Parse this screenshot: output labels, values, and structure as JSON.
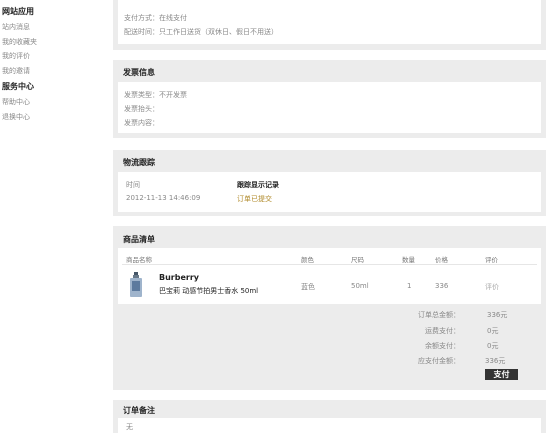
{
  "sidebar": {
    "sections": [
      {
        "title": "网站应用",
        "items": [
          "站内消息",
          "我的收藏夹",
          "我的评价",
          "我的邀请"
        ]
      },
      {
        "title": "服务中心",
        "items": [
          "帮助中心",
          "退换中心"
        ]
      }
    ]
  },
  "payment": {
    "method_line": "支付方式：在线支付",
    "time_line": "配送时间：只工作日送货（双休日、假日不用送）"
  },
  "invoice": {
    "title": "发票信息",
    "type_line": "发票类型：不开发票",
    "header_line": "发票抬头：",
    "content_line": "发票内容："
  },
  "logistics": {
    "title": "物流跟踪",
    "time_label": "时间",
    "time_value": "2012-11-13 14:46:09",
    "record_label": "跟踪显示记录",
    "record_value": "订单已提交"
  },
  "products": {
    "title": "商品清单",
    "headers": [
      "商品名称",
      "颜色",
      "尺码",
      "数量",
      "价格",
      "评价"
    ],
    "item": {
      "brand": "Burberry",
      "name": "巴宝莉 动感节拍男士香水 50ml",
      "color": "蓝色",
      "size": "50ml",
      "quantity": "1",
      "price": "336",
      "review": "评价"
    },
    "summary": [
      {
        "label": "订单总金额：",
        "value": "336元"
      },
      {
        "label": "运费支付：",
        "value": "0元"
      },
      {
        "label": "余额支付：",
        "value": "0元"
      },
      {
        "label": "应支付金额：",
        "value": "336元"
      }
    ],
    "pay_label": "支付"
  },
  "remark": {
    "title": "订单备注",
    "value": "无"
  }
}
